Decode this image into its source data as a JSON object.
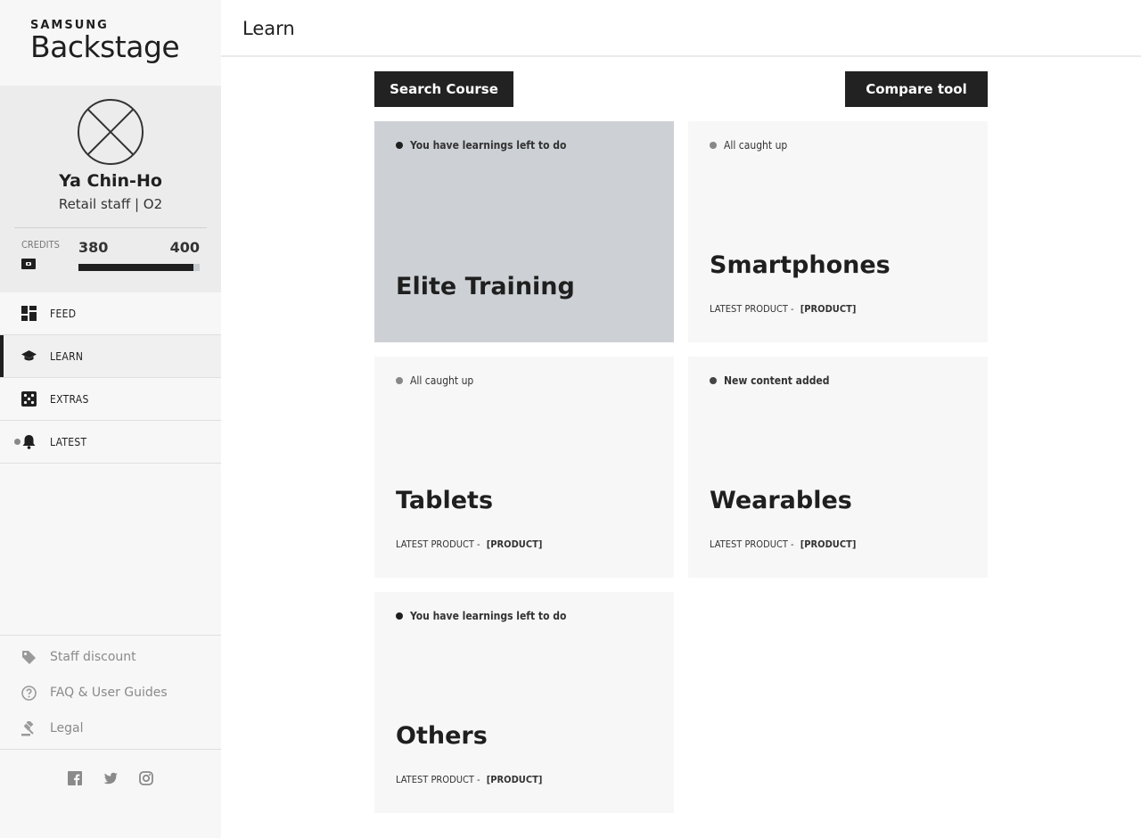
{
  "brand": {
    "top": "SAMSUNG",
    "name": "Backstage"
  },
  "profile": {
    "name": "Ya Chin-Ho",
    "role": "Retail staff | O2"
  },
  "credits": {
    "label": "CREDITS",
    "value": "380",
    "max": "400",
    "fraction": 0.95
  },
  "nav": [
    {
      "label": "FEED",
      "icon": "dashboard-icon"
    },
    {
      "label": "LEARN",
      "icon": "graduation-cap-icon",
      "active": true
    },
    {
      "label": "EXTRAS",
      "icon": "dice-icon"
    },
    {
      "label": "LATEST",
      "icon": "bell-icon"
    }
  ],
  "footer_links": [
    {
      "label": "Staff discount",
      "icon": "tag-icon"
    },
    {
      "label": "FAQ & User Guides",
      "icon": "help-circle-icon"
    },
    {
      "label": "Legal",
      "icon": "gavel-icon"
    }
  ],
  "social": [
    "facebook-icon",
    "twitter-icon",
    "instagram-icon"
  ],
  "header": {
    "title": "Learn"
  },
  "buttons": {
    "search": "Search Course",
    "compare": "Compare tool"
  },
  "cards": [
    {
      "status": "You have learnings left to do",
      "title": "Elite Training"
    },
    {
      "status": "All caught up",
      "title": "Smartphones",
      "latest_label": "LATEST PRODUCT  -",
      "latest_value": "[PRODUCT]"
    },
    {
      "status": "All caught up",
      "title": "Tablets",
      "latest_label": "LATEST PRODUCT  -",
      "latest_value": "[PRODUCT]"
    },
    {
      "status": "New content added",
      "title": "Wearables",
      "latest_label": "LATEST PRODUCT  -",
      "latest_value": "[PRODUCT]"
    },
    {
      "status": "You have learnings left to do",
      "title": "Others",
      "latest_label": "LATEST PRODUCT  -",
      "latest_value": "[PRODUCT]"
    }
  ],
  "colors": {
    "dark": "#222222",
    "highlight_card": "#cdd1d5",
    "card": "#f7f7f7",
    "sidebar": "#f7f7f7"
  }
}
